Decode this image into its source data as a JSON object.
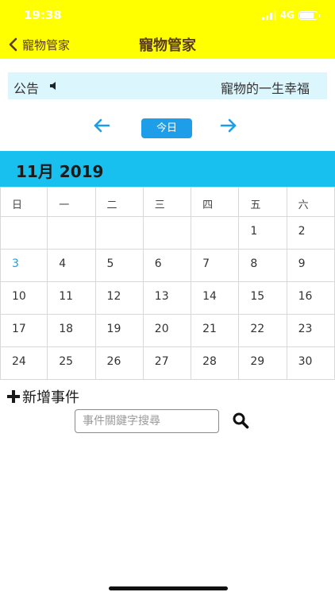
{
  "status_bar": {
    "time": "19:38",
    "network": "4G",
    "battery_level": 0.85
  },
  "nav": {
    "back_label": "寵物管家",
    "title": "寵物管家"
  },
  "announcement": {
    "label": "公告",
    "text": "寵物的一生幸福"
  },
  "controls": {
    "today_label": "今日"
  },
  "calendar": {
    "month_title": "11月 2019",
    "weekdays": [
      "日",
      "一",
      "二",
      "三",
      "四",
      "五",
      "六"
    ],
    "weeks": [
      [
        "",
        "",
        "",
        "",
        "",
        "1",
        "2"
      ],
      [
        "3",
        "4",
        "5",
        "6",
        "7",
        "8",
        "9"
      ],
      [
        "10",
        "11",
        "12",
        "13",
        "14",
        "15",
        "16"
      ],
      [
        "17",
        "18",
        "19",
        "20",
        "21",
        "22",
        "23"
      ],
      [
        "24",
        "25",
        "26",
        "27",
        "28",
        "29",
        "30"
      ]
    ],
    "highlighted_day": "3"
  },
  "events": {
    "add_label": "新增事件",
    "search_placeholder": "事件關鍵字搜尋"
  },
  "colors": {
    "header_bg": "#FFFF00",
    "announce_bg": "#DCF6FD",
    "accent": "#1E9EE8",
    "month_bg": "#17C0EE"
  }
}
